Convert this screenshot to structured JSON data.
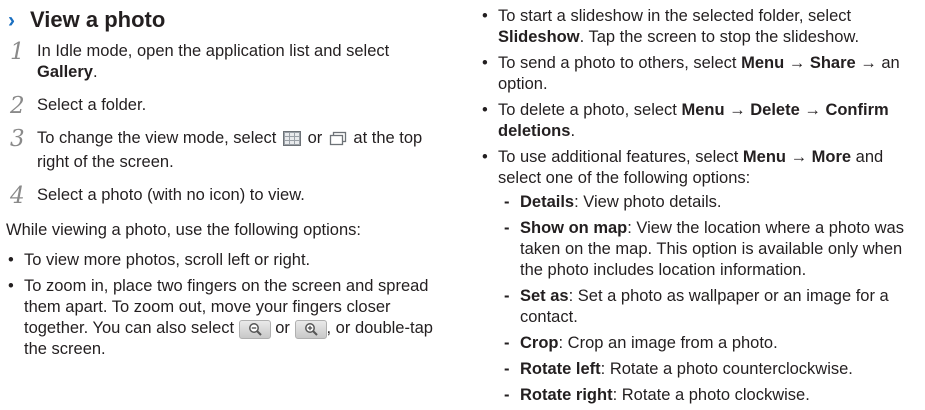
{
  "section": {
    "chevron": "›",
    "title": "View a photo"
  },
  "steps": [
    {
      "num": "1",
      "text_a": "In Idle mode, open the application list and select ",
      "bold": "Gallery",
      "text_b": "."
    },
    {
      "num": "2",
      "text": "Select a folder."
    },
    {
      "num": "3",
      "text_a": "To change the view mode, select ",
      "text_or": " or ",
      "text_b": " at the top right of the screen.",
      "icons": [
        "grid-view-icon",
        "folder-view-icon"
      ]
    },
    {
      "num": "4",
      "text": "Select a photo (with no icon) to view."
    }
  ],
  "intro": "While viewing a photo, use the following options:",
  "left_bullets": {
    "b1": "To view more photos, scroll left or right.",
    "b2_a": "To zoom in, place two fingers on the screen and spread them apart. To zoom out, move your fingers closer together. You can also select ",
    "b2_or": " or ",
    "b2_b": ", or double-tap the screen.",
    "icons": [
      "zoom-out-icon",
      "zoom-in-icon"
    ]
  },
  "right_bullets": {
    "slideshow_a": "To start a slideshow in the selected folder, select ",
    "slideshow_bold": "Slideshow",
    "slideshow_b": ". Tap the screen to stop the slideshow.",
    "share_a": "To send a photo to others, select ",
    "share_menu": "Menu",
    "arrow": " → ",
    "share_bold": "Share",
    "share_b": " → an option.",
    "delete_a": "To delete a photo, select ",
    "delete_menu": "Menu",
    "delete_bold": "Delete",
    "delete_confirm": "Confirm deletions",
    "delete_b": ".",
    "more_a": "To use additional features, select ",
    "more_menu": "Menu",
    "more_bold": "More",
    "more_b": " and select one of the following options:"
  },
  "options": [
    {
      "name": "Details",
      "desc": ": View photo details."
    },
    {
      "name": "Show on map",
      "desc": ": View the location where a photo was taken on the map. This option is available only when the photo includes location information."
    },
    {
      "name": "Set as",
      "desc": ": Set a photo as wallpaper or an image for a contact."
    },
    {
      "name": "Crop",
      "desc": ": Crop an image from a photo."
    },
    {
      "name": "Rotate left",
      "desc": ": Rotate a photo counterclockwise."
    },
    {
      "name": "Rotate right",
      "desc": ": Rotate a photo clockwise."
    }
  ]
}
